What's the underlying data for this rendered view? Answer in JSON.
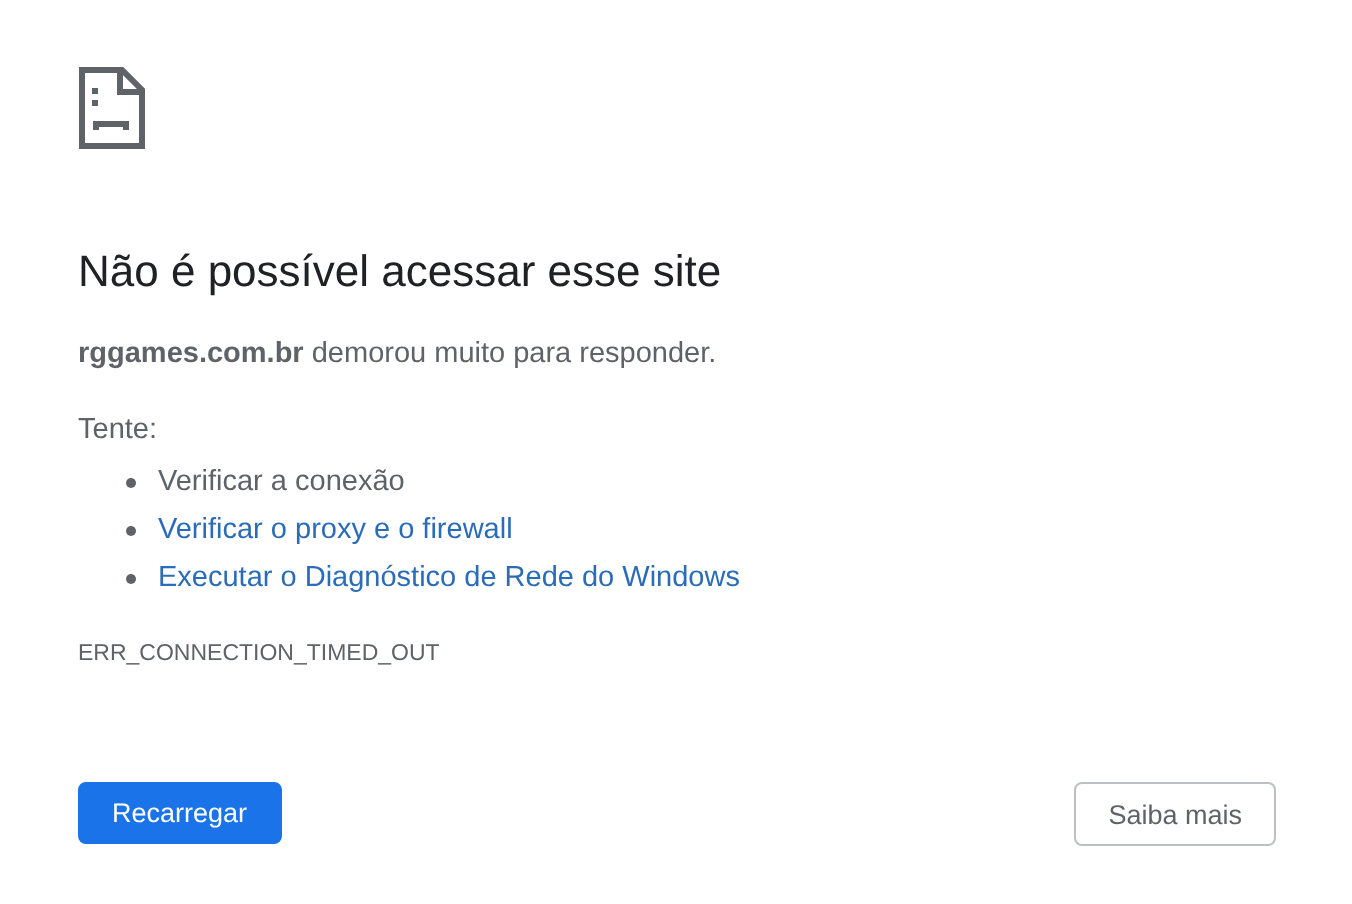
{
  "heading": "Não é possível acessar esse site",
  "summary": "**rggames.com.br** demorou muito para responder.",
  "suggestions": {
    "label": "Tente:",
    "items": [
      {
        "text": "Verificar a conexão",
        "kind": "text"
      },
      {
        "text": "Verificar o proxy e o firewall",
        "kind": "link"
      },
      {
        "text": "Executar o Diagnóstico de Rede do Windows",
        "kind": "link"
      }
    ]
  },
  "error_code": "ERR_CONNECTION_TIMED_OUT",
  "buttons": [
    {
      "label": "Recarregar",
      "kind": "primary"
    },
    {
      "label": "Saiba mais",
      "kind": "secondary"
    }
  ]
}
